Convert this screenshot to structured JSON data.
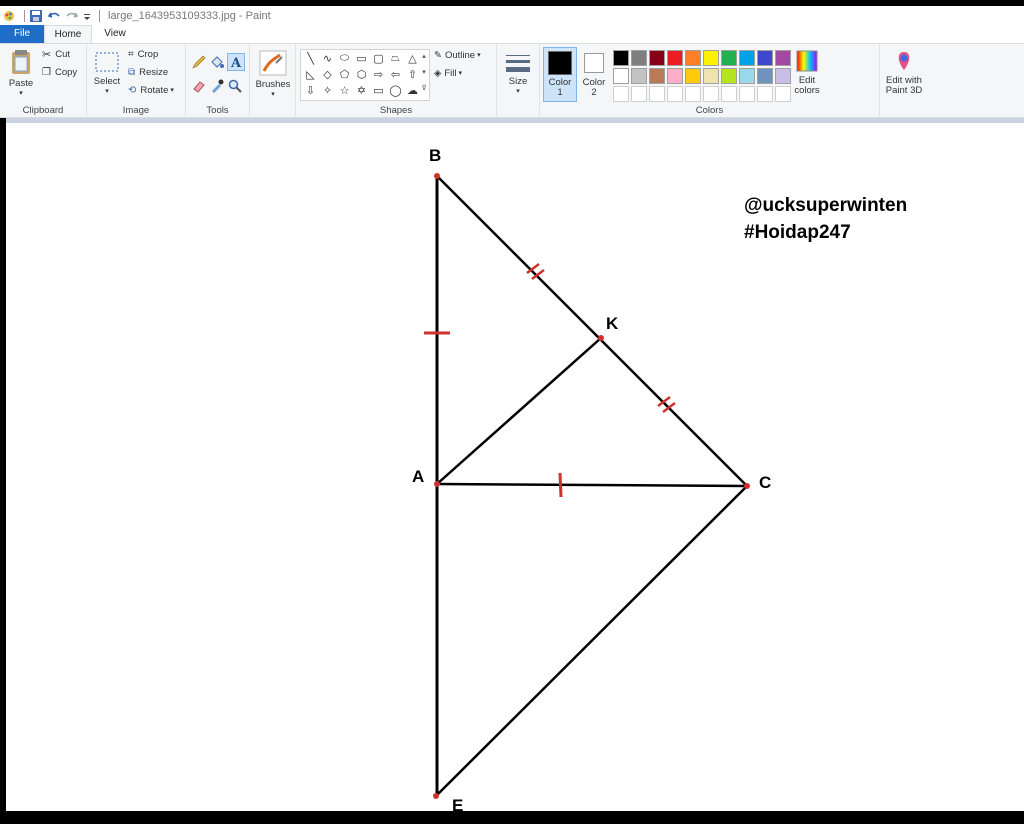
{
  "window": {
    "title": "large_1643953109333.jpg - Paint"
  },
  "quick_access": {
    "icons": [
      "paint-app-icon",
      "save-icon",
      "undo-icon",
      "redo-icon",
      "customize-qa-icon"
    ]
  },
  "tabs": [
    {
      "label": "File"
    },
    {
      "label": "Home"
    },
    {
      "label": "View"
    }
  ],
  "ribbon": {
    "clipboard": {
      "group": "Clipboard",
      "paste": "Paste",
      "cut": "Cut",
      "copy": "Copy"
    },
    "image": {
      "group": "Image",
      "select": "Select",
      "crop": "Crop",
      "resize": "Resize",
      "rotate": "Rotate"
    },
    "tools": {
      "group": "Tools"
    },
    "brushes": {
      "label": "Brushes"
    },
    "shapes": {
      "group": "Shapes",
      "outline": "Outline",
      "fill": "Fill"
    },
    "size": {
      "label": "Size"
    },
    "colors": {
      "group": "Colors",
      "color1": "Color",
      "color1_num": "1",
      "color2": "Color",
      "color2_num": "2",
      "edit_colors_1": "Edit",
      "edit_colors_2": "colors",
      "paint3d_1": "Edit with",
      "paint3d_2": "Paint 3D",
      "palette_row1": [
        "#000000",
        "#7f7f7f",
        "#880015",
        "#ed1c24",
        "#ff7f27",
        "#fff200",
        "#22b14c",
        "#00a2e8",
        "#3f48cc",
        "#a349a4"
      ],
      "palette_row2": [
        "#ffffff",
        "#c3c3c3",
        "#b97a57",
        "#ffaec9",
        "#ffc90e",
        "#efe4b0",
        "#b5e61d",
        "#99d9ea",
        "#7092be",
        "#c8bfe7"
      ],
      "palette_row3": [
        "#ffffff",
        "#ffffff",
        "#ffffff",
        "#ffffff",
        "#ffffff",
        "#ffffff",
        "#ffffff",
        "#ffffff",
        "#ffffff",
        "#ffffff"
      ]
    }
  },
  "drawing": {
    "labels": {
      "B": "B",
      "K": "K",
      "A": "A",
      "C": "C",
      "E": "E"
    },
    "watermark_line1": "@ucksuperwinten",
    "watermark_line2": "#Hoidap247",
    "line_color": "#000000",
    "mark_color": "#d0312d"
  }
}
